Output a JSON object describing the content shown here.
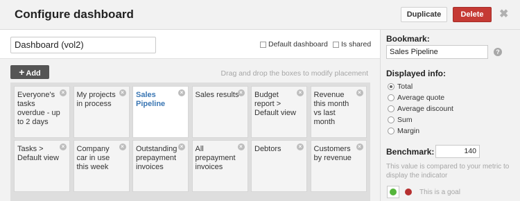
{
  "header": {
    "title": "Configure dashboard",
    "duplicate_label": "Duplicate",
    "delete_label": "Delete",
    "close_glyph": "✖"
  },
  "editor": {
    "name_value": "Dashboard (vol2)",
    "default_label": "Default dashboard",
    "shared_label": "Is shared",
    "add_label": "Add",
    "hint": "Drag and drop the boxes to modify placement"
  },
  "tiles": [
    {
      "label": "Everyone's tasks overdue - up to 2 days",
      "selected": false
    },
    {
      "label": "My projects in process",
      "selected": false
    },
    {
      "label": "Sales Pipeline",
      "selected": true
    },
    {
      "label": "Sales results",
      "selected": false
    },
    {
      "label": "Budget report > Default view",
      "selected": false
    },
    {
      "label": "Revenue this month vs last month",
      "selected": false
    },
    {
      "label": "Tasks > Default view",
      "selected": false
    },
    {
      "label": "Company car in use this week",
      "selected": false
    },
    {
      "label": "Outstanding prepayment invoices",
      "selected": false
    },
    {
      "label": "All prepayment invoices",
      "selected": false
    },
    {
      "label": "Debtors",
      "selected": false
    },
    {
      "label": "Customers by revenue",
      "selected": false
    }
  ],
  "sidebar": {
    "bookmark_label": "Bookmark:",
    "bookmark_value": "Sales Pipeline",
    "displayed_label": "Displayed info:",
    "options": [
      {
        "label": "Total",
        "checked": true
      },
      {
        "label": "Average quote",
        "checked": false
      },
      {
        "label": "Average discount",
        "checked": false
      },
      {
        "label": "Sum",
        "checked": false
      },
      {
        "label": "Margin",
        "checked": false
      }
    ],
    "benchmark_label": "Benchmark:",
    "benchmark_value": "140",
    "benchmark_note": "This value is compared to your metric to display the indicator",
    "goal_label": "This is a goal"
  },
  "colors": {
    "delete": "#c53a34",
    "link": "#3a76b3",
    "goal_green": "#56b63c",
    "goal_red": "#b63030"
  },
  "icons": {
    "add": "plus-icon",
    "close": "close-icon",
    "help": "help-icon",
    "tile_remove": "remove-icon"
  }
}
